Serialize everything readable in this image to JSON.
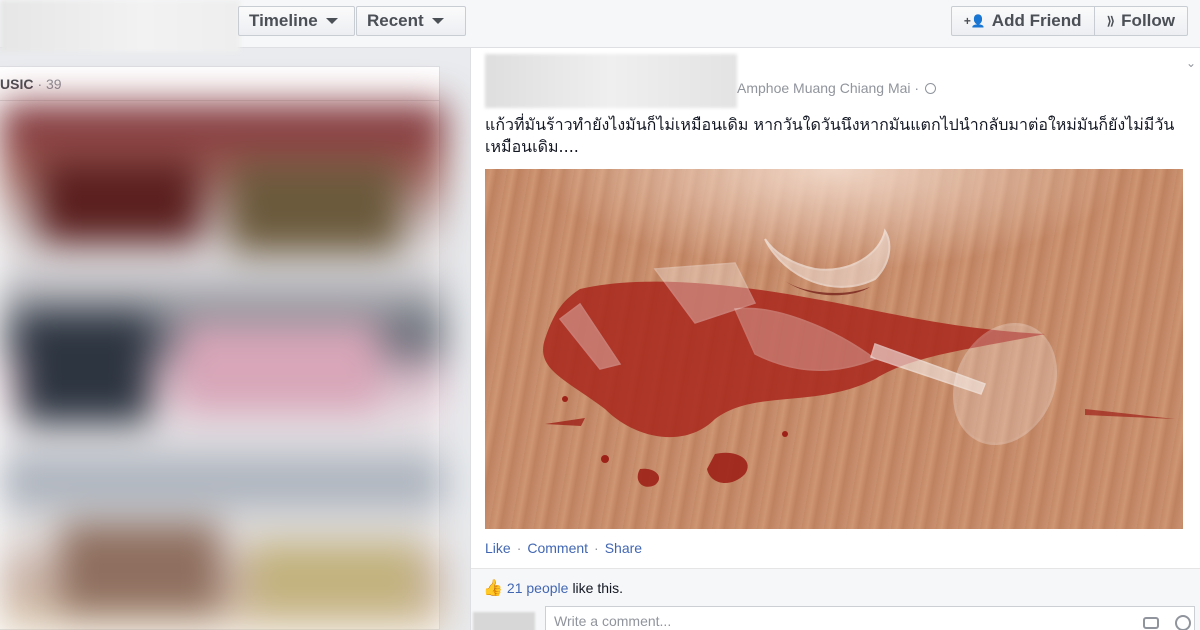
{
  "topbar": {
    "timeline_label": "Timeline",
    "recent_label": "Recent",
    "add_friend_label": "Add Friend",
    "follow_label": "Follow"
  },
  "leftcol": {
    "section_label": "USIC",
    "section_count": "· 39"
  },
  "post": {
    "location": "Amphoe Muang Chiang Mai ·",
    "text": "แก้วที่มันร้าวทำยังไงมันก็ไม่เหมือนเดิม หากวันใดวันนึงหากมันแตกไปนำกลับมาต่อใหม่มันก็ยังไม่มีวันเหมือนเดิม....",
    "actions": {
      "like": "Like",
      "comment": "Comment",
      "share": "Share",
      "separator": "·"
    },
    "likes": {
      "count_text": "21 people",
      "suffix": "like this."
    },
    "comment_placeholder": "Write a comment..."
  },
  "colors": {
    "link": "#4267b2",
    "muted": "#90949c",
    "wine": "#a8271c"
  }
}
